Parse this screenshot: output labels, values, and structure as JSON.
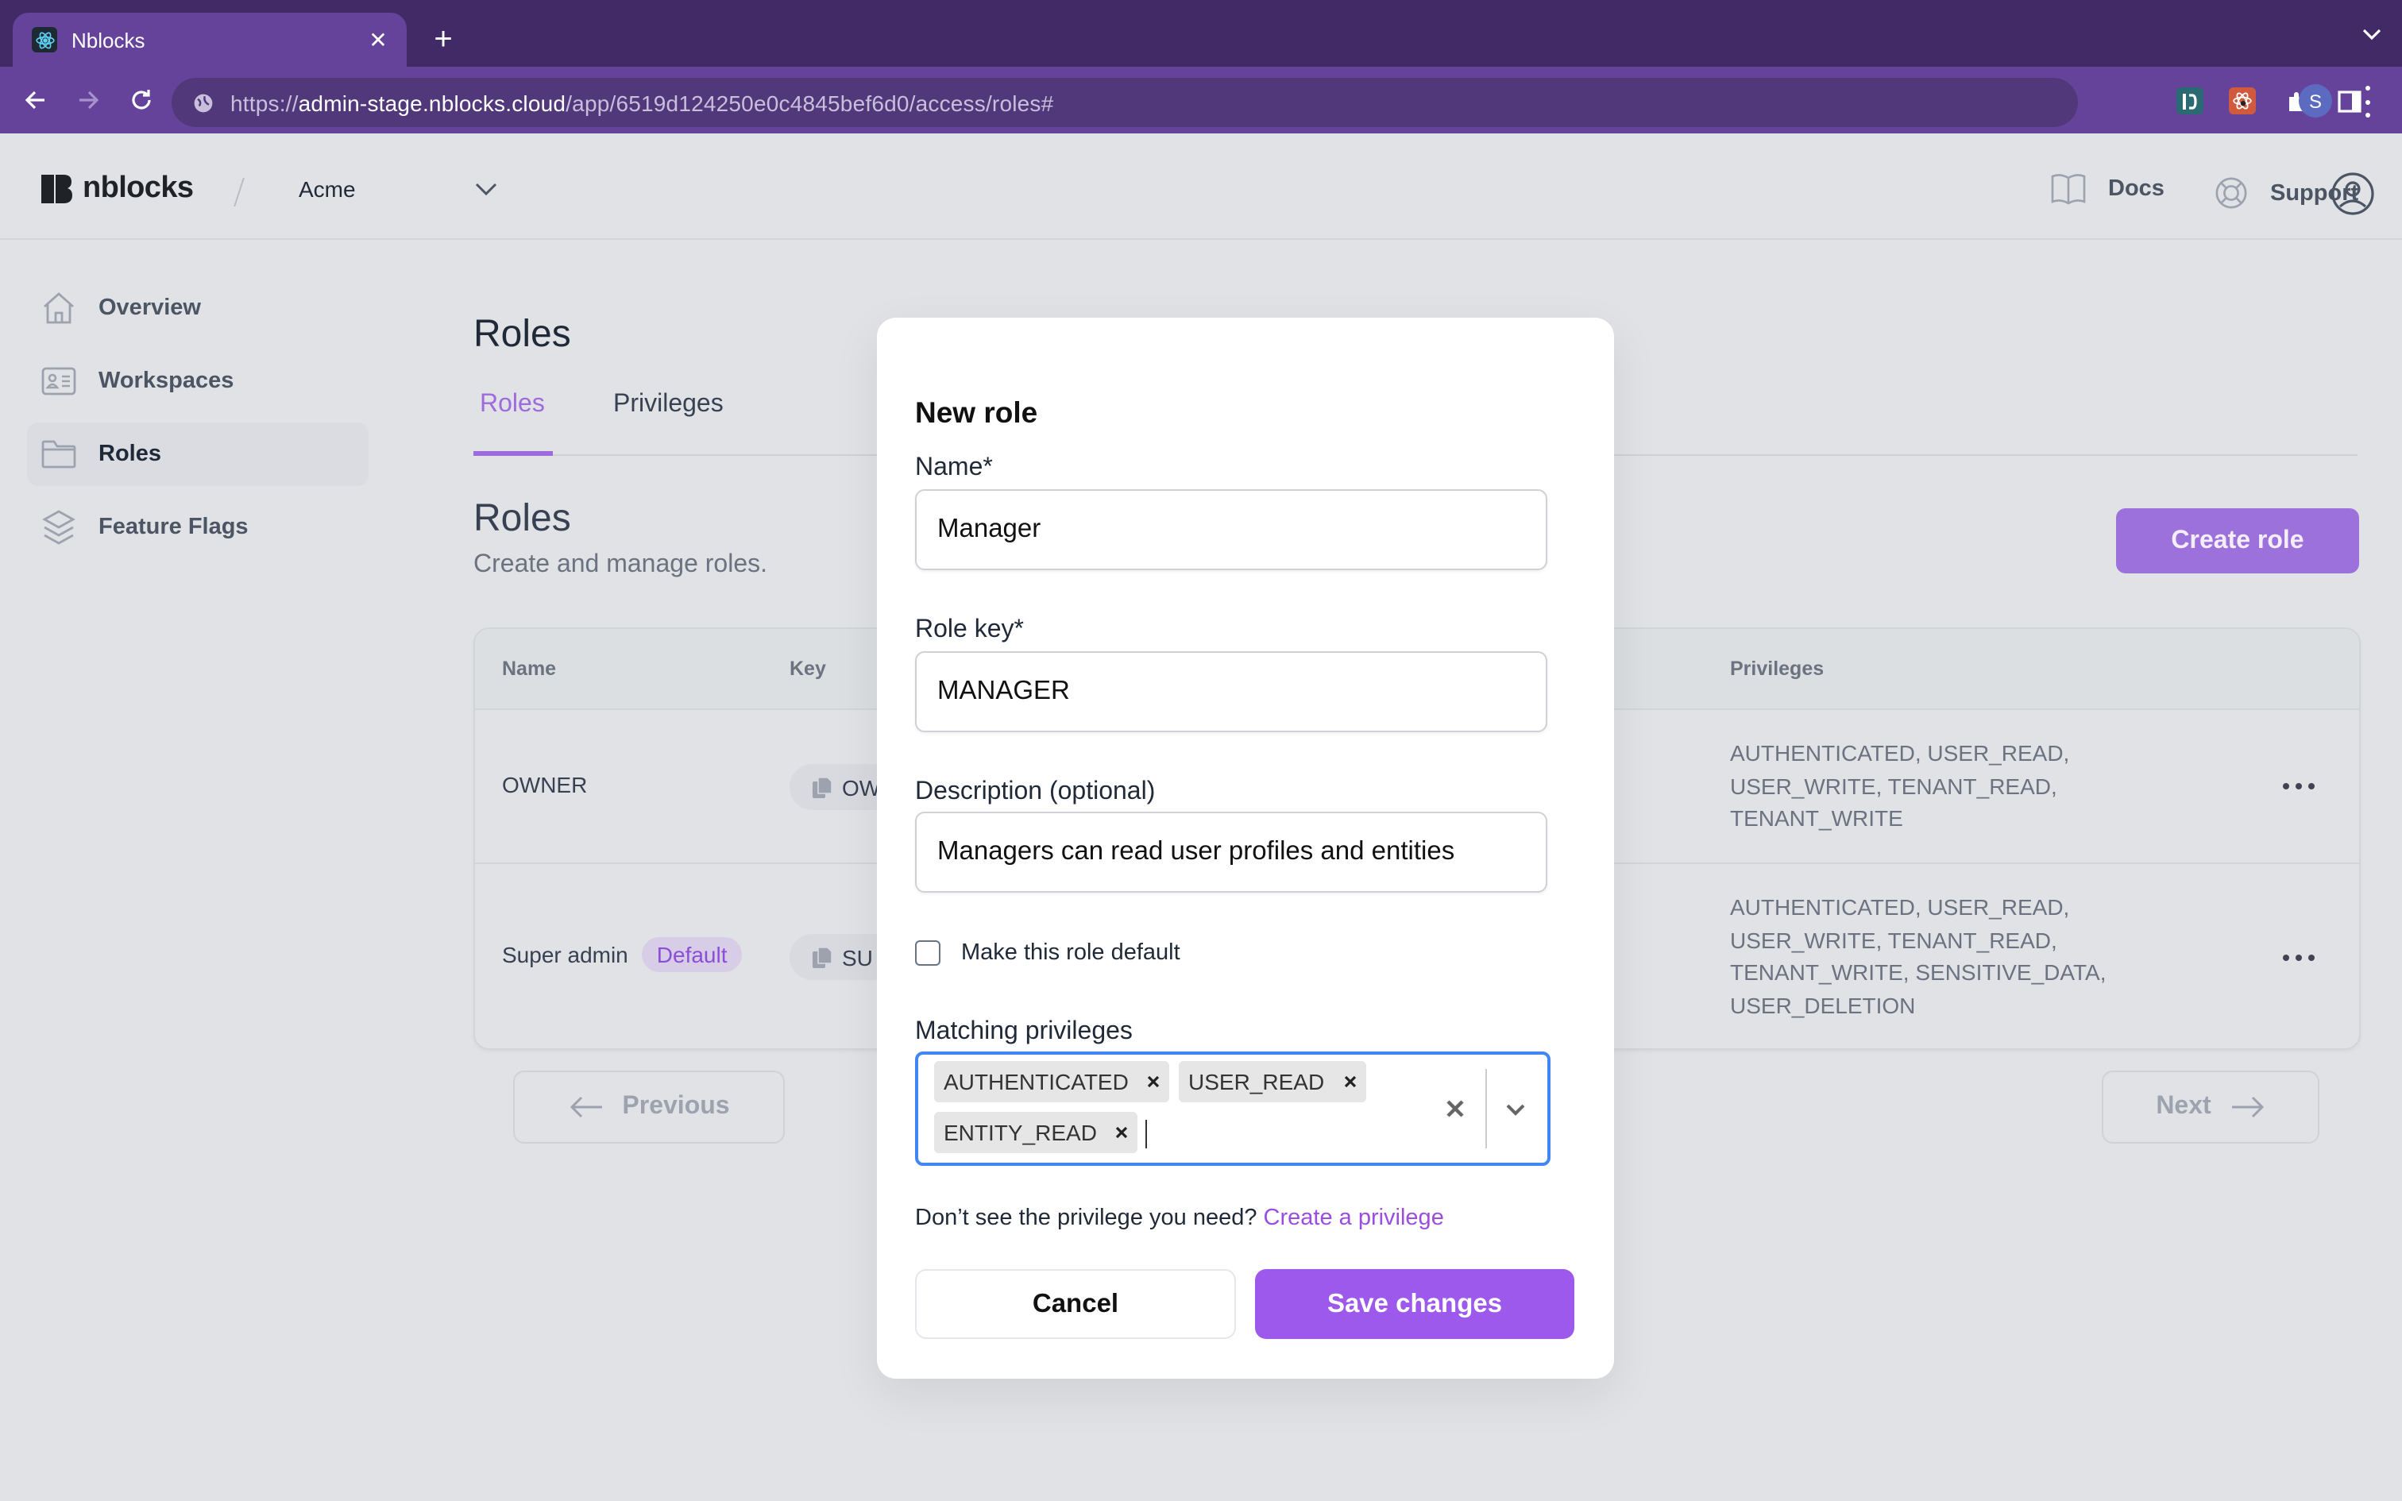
{
  "browser": {
    "tab_title": "Nblocks",
    "favicon": "react-atom-icon",
    "url_scheme": "https://",
    "url_host": "admin-stage.nblocks.cloud",
    "url_path": "/app/6519d124250e0c4845bef6d0/access/roles#",
    "profile_initial": "S",
    "extensions": [
      "dashlane-extension-icon",
      "react-devtools-extension-icon",
      "extensions-puzzle-icon",
      "side-panel-icon"
    ],
    "colors": {
      "tabstrip": "#412a66",
      "toolbar": "#66439a",
      "omnibox": "#51387a"
    }
  },
  "header": {
    "brand": "nblocks",
    "workspace": "Acme",
    "docs_label": "Docs",
    "support_label": "Support"
  },
  "sidebar": {
    "items": [
      {
        "label": "Overview",
        "icon": "home-icon",
        "active": false
      },
      {
        "label": "Workspaces",
        "icon": "id-card-icon",
        "active": false
      },
      {
        "label": "Roles",
        "icon": "folder-icon",
        "active": true
      },
      {
        "label": "Feature Flags",
        "icon": "layers-icon",
        "active": false
      }
    ]
  },
  "main": {
    "page_title": "Roles",
    "tabs": [
      {
        "label": "Roles",
        "active": true
      },
      {
        "label": "Privileges",
        "active": false
      }
    ],
    "section_title": "Roles",
    "section_subtitle": "Create and manage roles.",
    "create_button": "Create role",
    "accent_color": "#9d71dc",
    "table": {
      "columns": [
        "Name",
        "Key",
        "Privileges"
      ],
      "rows": [
        {
          "name": "OWNER",
          "badge": null,
          "key": "OW",
          "privileges": "AUTHENTICATED, USER_READ, USER_WRITE, TENANT_READ, TENANT_WRITE"
        },
        {
          "name": "Super admin",
          "badge": "Default",
          "key": "SU",
          "privileges": "AUTHENTICATED, USER_READ, USER_WRITE, TENANT_READ, TENANT_WRITE, SENSITIVE_DATA, USER_DELETION"
        }
      ]
    },
    "pagination": {
      "previous": "Previous",
      "next": "Next"
    }
  },
  "modal": {
    "title": "New role",
    "name_label": "Name*",
    "name_value": "Manager",
    "key_label": "Role key*",
    "key_value": "MANAGER",
    "description_label": "Description (optional)",
    "description_value": "Managers can read user profiles and entities",
    "default_checkbox_label": "Make this role default",
    "default_checked": false,
    "privileges_label": "Matching privileges",
    "selected_privileges": [
      "AUTHENTICATED",
      "USER_READ",
      "ENTITY_READ"
    ],
    "help_text": "Don’t see the privilege you need?",
    "help_link": "Create a privilege",
    "cancel_label": "Cancel",
    "save_label": "Save changes",
    "colors": {
      "save": "#9d59ec",
      "link": "#9b4de0",
      "focus_border": "#4285f4"
    }
  }
}
